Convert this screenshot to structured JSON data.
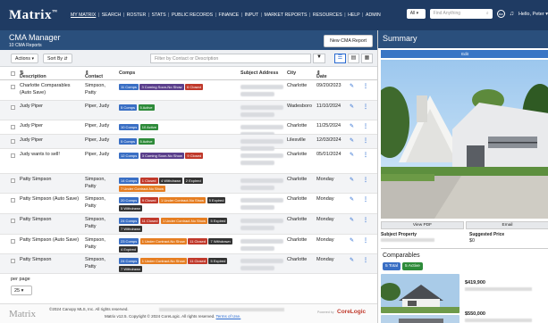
{
  "nav": {
    "logo": "Matrix",
    "trademark": "™",
    "links": [
      {
        "label": "MY MATRIX",
        "active": true
      },
      {
        "label": "SEARCH"
      },
      {
        "label": "ROSTER"
      },
      {
        "label": "STATS"
      },
      {
        "label": "PUBLIC RECORDS"
      },
      {
        "label": "FINANCE"
      },
      {
        "label": "INPUT"
      },
      {
        "label": "MARKET REPORTS"
      },
      {
        "label": "RESOURCES"
      },
      {
        "label": "HELP"
      },
      {
        "label": "ADMIN"
      }
    ],
    "search_scope": "All",
    "search_placeholder": "Find Anything",
    "avatar_initials": "Aa",
    "greeting": "Hello, Peter"
  },
  "cma": {
    "title": "CMA Manager",
    "subtitle": "10 CMA Reports",
    "new_button": "New CMA Report",
    "actions_label": "Actions",
    "sort_label": "Sort By",
    "filter_placeholder": "Filter by Contact or Description"
  },
  "table": {
    "headers": {
      "description": "Description",
      "contact": "Contact",
      "comps": "Comps",
      "address": "Subject Address",
      "city": "City",
      "date": "Date"
    },
    "rows": [
      {
        "description": "Charlotte Comparables (Auto Save)",
        "contact": "Simpson, Patty",
        "city": "Charlotte",
        "date": "09/20/2023",
        "badges": [
          {
            "t": "11 Comps",
            "c": "#3a6fc4"
          },
          {
            "t": "3 Coming Soon-No Show",
            "c": "#5b3f8c"
          },
          {
            "t": "6 Closed",
            "c": "#c0392b"
          }
        ]
      },
      {
        "description": "Judy Piper",
        "contact": "Piper, Judy",
        "city": "Wadesboro",
        "date": "11/10/2024",
        "badges": [
          {
            "t": "5 Comps",
            "c": "#3a6fc4"
          },
          {
            "t": "5 Active",
            "c": "#2e8b3a"
          }
        ]
      },
      {
        "description": "Judy Piper",
        "contact": "Piper, Judy",
        "city": "Charlotte",
        "date": "11/25/2024",
        "badges": [
          {
            "t": "10 Comps",
            "c": "#3a6fc4"
          },
          {
            "t": "10 Active",
            "c": "#2e8b3a"
          }
        ]
      },
      {
        "description": "Judy Piper",
        "contact": "Piper, Judy",
        "city": "Lilesville",
        "date": "12/03/2024",
        "badges": [
          {
            "t": "5 Comps",
            "c": "#3a6fc4"
          },
          {
            "t": "5 Active",
            "c": "#2e8b3a"
          }
        ]
      },
      {
        "description": "Judy wants to sell!",
        "contact": "Piper, Judy",
        "city": "Charlotte",
        "date": "05/01/2024",
        "badges": [
          {
            "t": "12 Comps",
            "c": "#3a6fc4"
          },
          {
            "t": "3 Coming Soon-No Show",
            "c": "#5b3f8c"
          },
          {
            "t": "9 Closed",
            "c": "#c0392b"
          }
        ]
      },
      {
        "description": "Patty Simpson",
        "contact": "Simpson, Patty",
        "city": "Charlotte",
        "date": "Monday",
        "badges": [
          {
            "t": "14 Comps",
            "c": "#3a6fc4"
          },
          {
            "t": "1 Closed",
            "c": "#c0392b"
          },
          {
            "t": "4 Withdrawn",
            "c": "#333333"
          },
          {
            "t": "2 Expired",
            "c": "#333333"
          },
          {
            "t": "7 Under Contract-No Show",
            "c": "#e67e22"
          }
        ]
      },
      {
        "description": "Patty Simpson (Auto Save)",
        "contact": "Simpson, Patty",
        "city": "Charlotte",
        "date": "Monday",
        "badges": [
          {
            "t": "20 Comps",
            "c": "#3a6fc4"
          },
          {
            "t": "9 Closed",
            "c": "#c0392b"
          },
          {
            "t": "1 Under Contract-No Show",
            "c": "#e67e22"
          },
          {
            "t": "5 Expired",
            "c": "#333333"
          },
          {
            "t": "5 Withdrawn",
            "c": "#333333"
          }
        ]
      },
      {
        "description": "Patty Simpson",
        "contact": "Simpson, Patty",
        "city": "Charlotte",
        "date": "Monday",
        "badges": [
          {
            "t": "24 Comps",
            "c": "#3a6fc4"
          },
          {
            "t": "11 Closed",
            "c": "#c0392b"
          },
          {
            "t": "1 Under Contract-No Show",
            "c": "#e67e22"
          },
          {
            "t": "5 Expired",
            "c": "#333333"
          },
          {
            "t": "7 Withdrawn",
            "c": "#333333"
          }
        ]
      },
      {
        "description": "Patty Simpson (Auto Save)",
        "contact": "Simpson, Patty",
        "city": "Charlotte",
        "date": "Monday",
        "badges": [
          {
            "t": "23 Comps",
            "c": "#3a6fc4"
          },
          {
            "t": "1 Under Contract-No Show",
            "c": "#e67e22"
          },
          {
            "t": "11 Closed",
            "c": "#c0392b"
          },
          {
            "t": "7 Withdrawn",
            "c": "#333333"
          },
          {
            "t": "4 Expired",
            "c": "#333333"
          }
        ]
      },
      {
        "description": "Patty Simpson",
        "contact": "Simpson, Patty",
        "city": "Charlotte",
        "date": "Monday",
        "badges": [
          {
            "t": "24 Comps",
            "c": "#3a6fc4"
          },
          {
            "t": "1 Under Contract-No Show",
            "c": "#e67e22"
          },
          {
            "t": "11 Closed",
            "c": "#c0392b"
          },
          {
            "t": "5 Expired",
            "c": "#333333"
          },
          {
            "t": "7 Withdrawn",
            "c": "#333333"
          }
        ]
      }
    ]
  },
  "pagination": {
    "per_page_label": "per page",
    "per_page_value": "25"
  },
  "footer": {
    "logo": "Matrix",
    "copyright1": "©2024 Canopy MLS, Inc. All rights reserved.",
    "copyright2": "Matrix v12.5. Copyright © 2024 CoreLogic. All rights reserved.",
    "terms": "Terms of Use.",
    "powered": "Powered by",
    "brand": "CoreLogic"
  },
  "summary": {
    "title": "Summary",
    "edit_label": "Edit",
    "view_pdf": "View PDF",
    "email": "Email",
    "subject_label": "Subject Property",
    "suggested_label": "Suggested Price",
    "suggested_value": "$0",
    "comparables_label": "Comparables",
    "total_badge": "5 Total",
    "active_badge": "5 Active",
    "comp_prices": [
      "$419,900",
      "$550,000"
    ]
  },
  "colors": {
    "nav_bg": "#1f3b63",
    "header_bg": "#2a4f7c",
    "accent": "#2a6bd1"
  }
}
